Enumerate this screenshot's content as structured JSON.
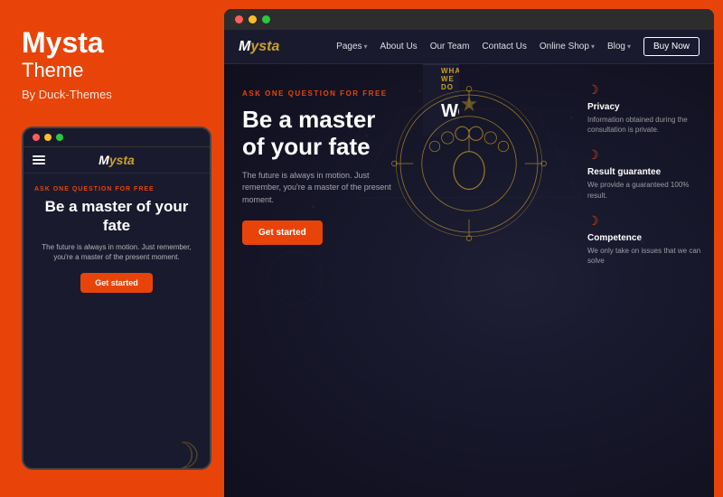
{
  "brand": {
    "title": "Mysta",
    "subtitle": "Theme",
    "by": "By Duck-Themes"
  },
  "mobile": {
    "ask_label": "ASK ONE QUESTION FOR FREE",
    "headline": "Be a master of your fate",
    "subtext": "The future is always in motion. Just remember, you're a master of the present moment.",
    "cta": "Get started"
  },
  "nav": {
    "logo": "Mysta",
    "links": [
      {
        "label": "Pages",
        "has_arrow": true
      },
      {
        "label": "About Us",
        "has_arrow": false
      },
      {
        "label": "Our Team",
        "has_arrow": false
      },
      {
        "label": "Contact Us",
        "has_arrow": false
      },
      {
        "label": "Online Shop",
        "has_arrow": true
      },
      {
        "label": "Blog",
        "has_arrow": true
      }
    ],
    "buy_btn": "Buy Now"
  },
  "hero": {
    "ask_label": "ASK ONE QUESTION FOR FREE",
    "headline_line1": "Be a master",
    "headline_line2": "of your fate",
    "subtext": "The future is always in motion. Just remember, you're a master of the present moment.",
    "cta": "Get started",
    "features": [
      {
        "icon": "🌙",
        "title": "Privacy",
        "text": "Information obtained during the consultation is private."
      },
      {
        "icon": "🌙",
        "title": "Result guarantee",
        "text": "We provide a guaranteed 100% result."
      },
      {
        "icon": "🌙",
        "title": "Competence",
        "text": "We only take on issues that we can solve"
      }
    ]
  },
  "bottom": {
    "what_label": "WHAT WE DO",
    "headline": "We know everything about"
  },
  "colors": {
    "accent": "#e8440a",
    "gold": "#c8a02a",
    "dark": "#1a1a2e",
    "text_muted": "rgba(255,255,255,0.6)"
  }
}
